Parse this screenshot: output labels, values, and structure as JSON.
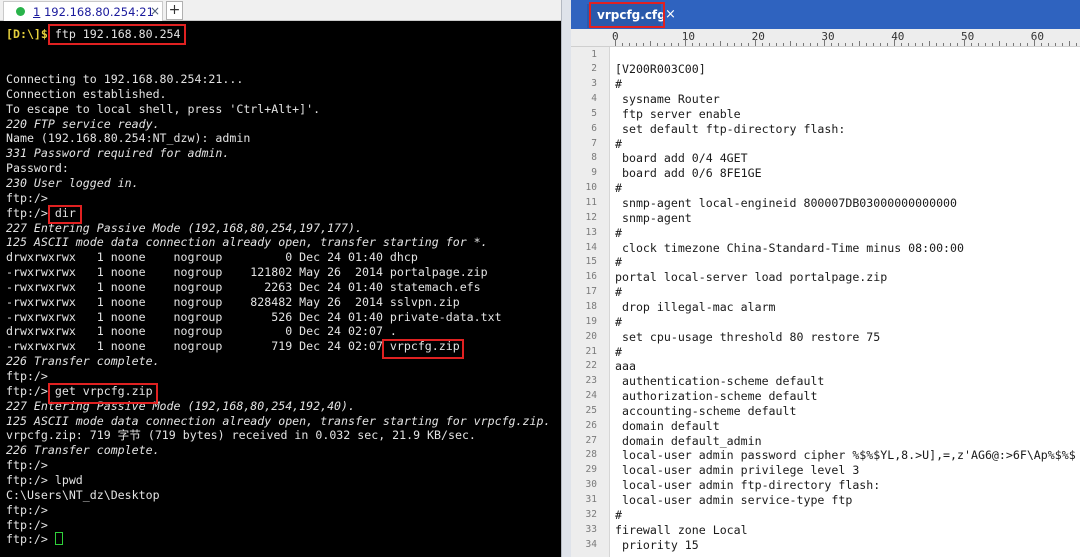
{
  "terminal": {
    "tab": {
      "number": "1",
      "title": "192.168.80.254:21",
      "close": "×"
    },
    "new_tab": "+",
    "first_command": {
      "prompt": "[D:\\]$",
      "command": "ftp 192.168.80.254"
    },
    "lines": [
      {
        "t": "Connecting to 192.168.80.254:21..."
      },
      {
        "t": "Connection established."
      },
      {
        "t": "To escape to local shell, press 'Ctrl+Alt+]'."
      },
      {
        "t": "220 FTP service ready.",
        "it": true
      },
      {
        "t": "Name (192.168.80.254:NT_dzw): admin"
      },
      {
        "t": "331 Password required for admin.",
        "it": true
      },
      {
        "t": "Password:"
      },
      {
        "t": "230 User logged in.",
        "it": true
      },
      {
        "t": "ftp:/>"
      },
      {
        "t": "ftp:/> dir"
      },
      {
        "t": "227 Entering Passive Mode (192,168,80,254,197,177).",
        "it": true
      },
      {
        "t": "125 ASCII mode data connection already open, transfer starting for *.",
        "it": true
      },
      {
        "t": "drwxrwxrwx   1 noone    nogroup         0 Dec 24 01:40 dhcp"
      },
      {
        "t": "-rwxrwxrwx   1 noone    nogroup    121802 May 26  2014 portalpage.zip"
      },
      {
        "t": "-rwxrwxrwx   1 noone    nogroup      2263 Dec 24 01:40 statemach.efs"
      },
      {
        "t": "-rwxrwxrwx   1 noone    nogroup    828482 May 26  2014 sslvpn.zip"
      },
      {
        "t": "-rwxrwxrwx   1 noone    nogroup       526 Dec 24 01:40 private-data.txt"
      },
      {
        "t": "drwxrwxrwx   1 noone    nogroup         0 Dec 24 02:07 ."
      },
      {
        "t": "-rwxrwxrwx   1 noone    nogroup       719 Dec 24 02:07 vrpcfg.zip"
      },
      {
        "t": "226 Transfer complete.",
        "it": true
      },
      {
        "t": "ftp:/>"
      },
      {
        "t": "ftp:/> get vrpcfg.zip"
      },
      {
        "t": "227 Entering Passive Mode (192,168,80,254,192,40).",
        "it": true
      },
      {
        "t": "125 ASCII mode data connection already open, transfer starting for vrpcfg.zip.",
        "it": true
      },
      {
        "t": "vrpcfg.zip: 719 字节 (719 bytes) received in 0.032 sec, 21.9 KB/sec."
      },
      {
        "t": "226 Transfer complete.",
        "it": true
      },
      {
        "t": "ftp:/>"
      },
      {
        "t": "ftp:/> lpwd"
      },
      {
        "t": "C:\\Users\\NT_dz\\Desktop"
      },
      {
        "t": "ftp:/>"
      },
      {
        "t": "ftp:/>"
      },
      {
        "t": "ftp:/> "
      }
    ]
  },
  "editor": {
    "tab": {
      "label": "vrpcfg.cfg",
      "close": "×"
    },
    "ruler": [
      "0",
      "10",
      "20",
      "30",
      "40",
      "50",
      "60"
    ],
    "lines": [
      "",
      "[V200R003C00]",
      "#",
      " sysname Router",
      " ftp server enable",
      " set default ftp-directory flash:",
      "#",
      " board add 0/4 4GET",
      " board add 0/6 8FE1GE",
      "#",
      " snmp-agent local-engineid 800007DB03000000000000",
      " snmp-agent",
      "#",
      " clock timezone China-Standard-Time minus 08:00:00",
      "#",
      "portal local-server load portalpage.zip",
      "#",
      " drop illegal-mac alarm",
      "#",
      " set cpu-usage threshold 80 restore 75",
      "#",
      "aaa",
      " authentication-scheme default",
      " authorization-scheme default",
      " accounting-scheme default",
      " domain default",
      " domain default_admin",
      " local-user admin password cipher %$%$YL,8.>U],=,z'AG6@:>6F\\Ap%$%$",
      " local-user admin privilege level 3",
      " local-user admin ftp-directory flash:",
      " local-user admin service-type ftp",
      "#",
      "firewall zone Local",
      " priority 15"
    ]
  },
  "colors": {
    "terminal_bg": "#000000",
    "terminal_text": "#e3e3e3",
    "prompt": "#e6d03c",
    "highlight_box": "#e02121",
    "editor_tabbar": "#2f63bf",
    "cursor": "#2fd13a",
    "status_dot": "#29b34a"
  }
}
